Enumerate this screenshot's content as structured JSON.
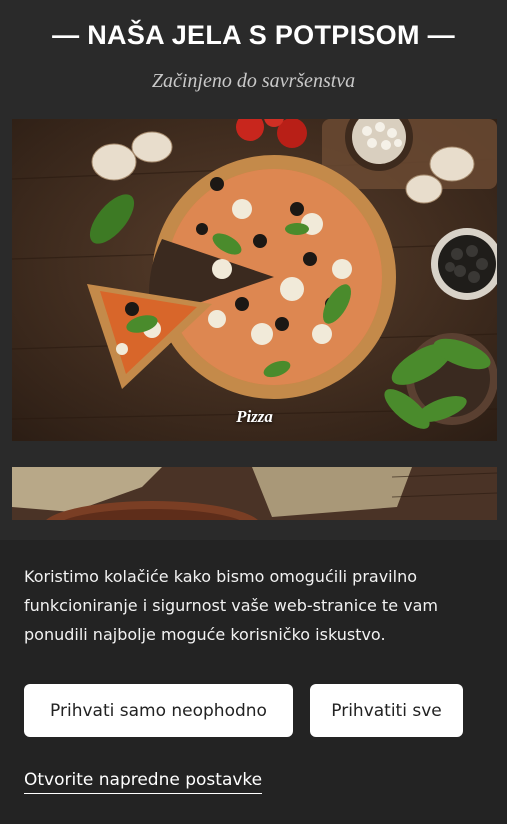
{
  "section": {
    "title": "— NAŠA JELA S POTPISOM —",
    "subtitle": "Začinjeno do savršenstva"
  },
  "dishes": [
    {
      "label": "Pizza"
    }
  ],
  "cookie_banner": {
    "text": "Koristimo kolačiće kako bismo omogućili pravilno funkcioniranje i sigurnost vaše web-stranice te vam ponudili najbolje moguće korisničko iskustvo.",
    "accept_necessary_label": "Prihvati samo neophodno",
    "accept_all_label": "Prihvatiti sve",
    "advanced_settings_label": "Otvorite napredne postavke"
  },
  "colors": {
    "background": "#2a2a2a",
    "banner": "#232323",
    "button": "#ffffff",
    "text": "#ffffff"
  }
}
